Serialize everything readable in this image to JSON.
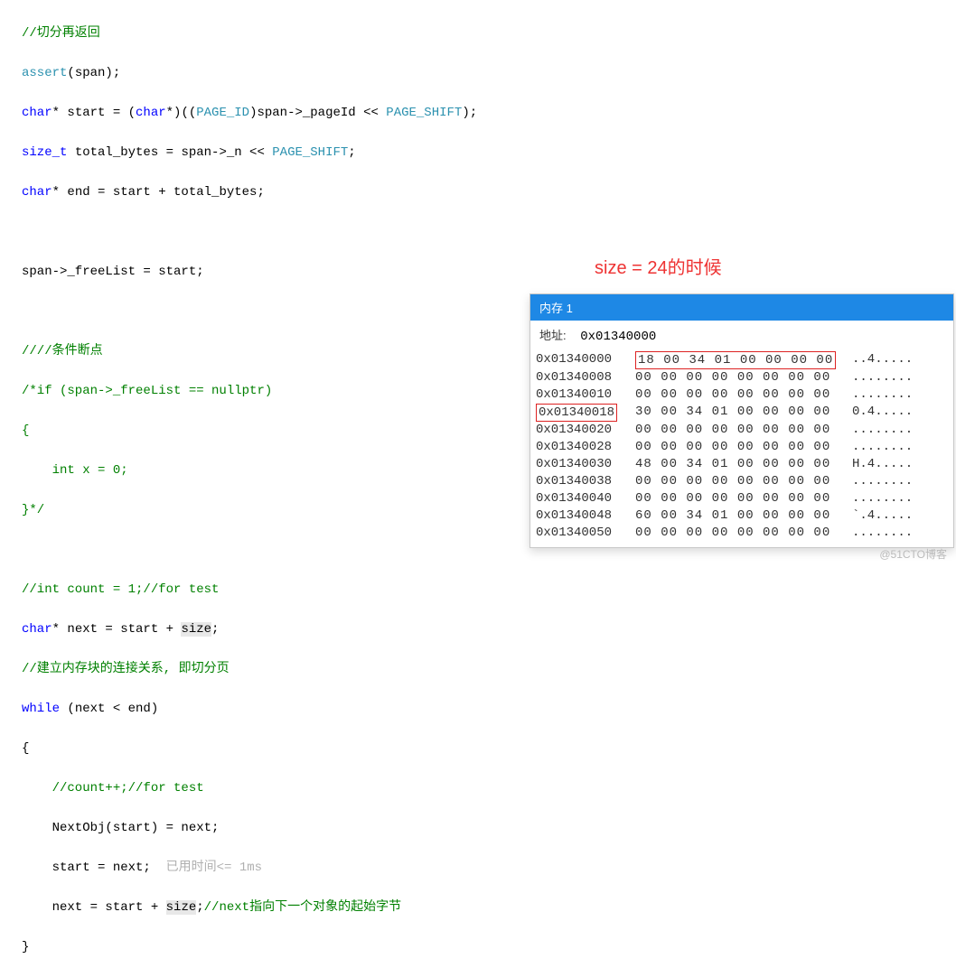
{
  "code": {
    "l1": "//切分再返回",
    "l2a": "assert",
    "l2b": "(span);",
    "l3": {
      "t": "char",
      "s": "* start = (",
      "t2": "char",
      "s2": "*)((",
      "m": "PAGE_ID",
      "s3": ")span->_pageId << ",
      "m2": "PAGE_SHIFT",
      "s4": ");"
    },
    "l4": {
      "t": "size_t",
      "s": " total_bytes = span->_n << ",
      "m": "PAGE_SHIFT",
      "s2": ";"
    },
    "l5": {
      "t": "char",
      "s": "* end = start + total_bytes;"
    },
    "l6": "span->_freeList = start;",
    "l7": "////条件断点",
    "l8": "/*if (span->_freeList == nullptr)",
    "l9": "{",
    "l10": "    int x = 0;",
    "l11": "}*/",
    "l12": "//int count = 1;//for test",
    "l13": {
      "t": "char",
      "s": "* next = start + ",
      "h": "size",
      "s2": ";"
    },
    "l14": "//建立内存块的连接关系, 即切分页",
    "l15": {
      "k": "while",
      "s": " (next < end)"
    },
    "l16": "{",
    "l17": "    //count++;//for test",
    "l18": "    NextObj(start) = next;",
    "l19": "    start = next;",
    "hint": "已用时间<= 1ms",
    "l20": {
      "s": "    next = start + ",
      "h": "size",
      "s2": ";",
      "c": "//next指向下一个对象的起始字节"
    },
    "l21": "}"
  },
  "note": "size =  24的时候",
  "memory": {
    "title": "内存 1",
    "addrLabel": "地址:",
    "addrValue": "0x01340000",
    "rows": [
      {
        "addr": "0x01340000",
        "bytes": "18 00 34 01 00 00 00 00",
        "ascii": "..4.....",
        "boxBytes": true
      },
      {
        "addr": "0x01340008",
        "bytes": "00 00 00 00 00 00 00 00",
        "ascii": "........"
      },
      {
        "addr": "0x01340010",
        "bytes": "00 00 00 00 00 00 00 00",
        "ascii": "........"
      },
      {
        "addr": "0x01340018",
        "bytes": "30 00 34 01 00 00 00 00",
        "ascii": "0.4.....",
        "boxAddr": true
      },
      {
        "addr": "0x01340020",
        "bytes": "00 00 00 00 00 00 00 00",
        "ascii": "........"
      },
      {
        "addr": "0x01340028",
        "bytes": "00 00 00 00 00 00 00 00",
        "ascii": "........"
      },
      {
        "addr": "0x01340030",
        "bytes": "48 00 34 01 00 00 00 00",
        "ascii": "H.4....."
      },
      {
        "addr": "0x01340038",
        "bytes": "00 00 00 00 00 00 00 00",
        "ascii": "........"
      },
      {
        "addr": "0x01340040",
        "bytes": "00 00 00 00 00 00 00 00",
        "ascii": "........"
      },
      {
        "addr": "0x01340048",
        "bytes": "60 00 34 01 00 00 00 00",
        "ascii": "`.4....."
      },
      {
        "addr": "0x01340050",
        "bytes": "00 00 00 00 00 00 00 00",
        "ascii": "........"
      }
    ]
  },
  "watermark": "@51CTO博客"
}
